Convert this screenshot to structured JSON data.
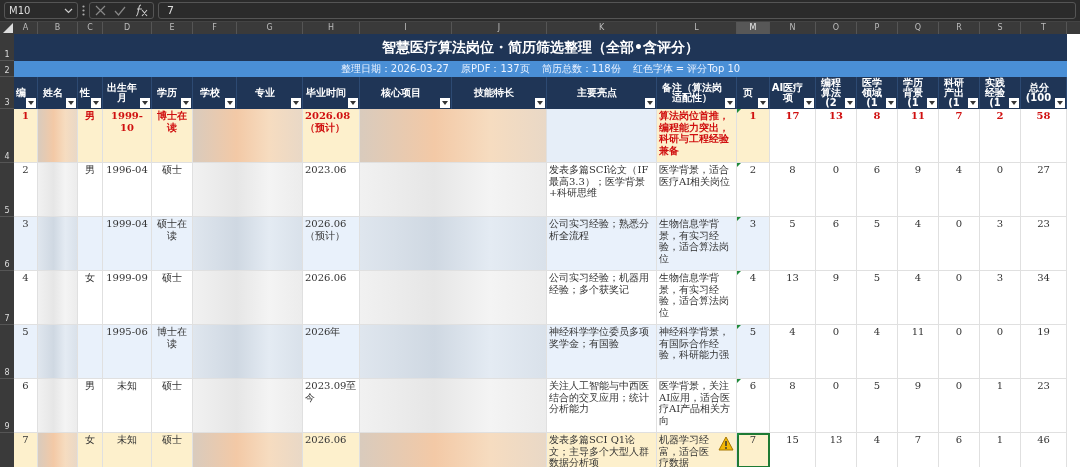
{
  "formula_bar": {
    "cell_ref": "M10",
    "value": "7"
  },
  "columns": [
    {
      "letter": "A",
      "selected": false
    },
    {
      "letter": "B",
      "selected": false
    },
    {
      "letter": "C",
      "selected": false
    },
    {
      "letter": "D",
      "selected": false
    },
    {
      "letter": "E",
      "selected": false
    },
    {
      "letter": "F",
      "selected": false
    },
    {
      "letter": "G",
      "selected": false
    },
    {
      "letter": "H",
      "selected": false
    },
    {
      "letter": "I",
      "selected": false
    },
    {
      "letter": "J",
      "selected": false
    },
    {
      "letter": "K",
      "selected": false
    },
    {
      "letter": "L",
      "selected": false
    },
    {
      "letter": "M",
      "selected": true
    },
    {
      "letter": "N",
      "selected": false
    },
    {
      "letter": "O",
      "selected": false
    },
    {
      "letter": "P",
      "selected": false
    },
    {
      "letter": "Q",
      "selected": false
    },
    {
      "letter": "R",
      "selected": false
    },
    {
      "letter": "S",
      "selected": false
    },
    {
      "letter": "T",
      "selected": false
    }
  ],
  "title": {
    "row_label": "1",
    "text": "智慧医疗算法岗位・简历筛选整理（全部•含评分）"
  },
  "info": {
    "row_label": "2",
    "items": [
      "整理日期：2026-03-27",
      "原PDF：137页",
      "简历总数：118份",
      "红色字体 = 评分Top 10"
    ]
  },
  "header_row_label": "3",
  "headers": [
    "编",
    "姓名",
    "性",
    "出生年月",
    "学历",
    "学校",
    "专业",
    "毕业时间",
    "核心项目",
    "技能特长",
    "主要亮点",
    "备注（算法岗适配性）",
    "页",
    "AI医疗项",
    "编程算法(2",
    "医学领域(1",
    "学历背景(1",
    "科研产出(1",
    "实践经验(1",
    "总分(100"
  ],
  "rows": [
    {
      "row_label": "4",
      "color": "#fdf0cc",
      "top10": true,
      "no": "1",
      "gender": "男",
      "birth": "1999-10",
      "education": "博士在读",
      "graduation": "2026.08（预计）",
      "highlight": "",
      "note": "算法岗位首推，编程能力突出，科研与工程经验兼备",
      "page": "1",
      "page_selected": false,
      "warning": false,
      "scores": [
        "17",
        "13",
        "8",
        "11",
        "7",
        "2",
        "58"
      ]
    },
    {
      "row_label": "5",
      "color": "#ffffff",
      "top10": false,
      "no": "2",
      "gender": "男",
      "birth": "1996-04",
      "education": "硕士",
      "graduation": "2023.06",
      "highlight": "发表多篇SCI论文（IF最高3.3）；医学背景+科研思维",
      "note": "医学背景，适合医疗AI相关岗位",
      "page": "2",
      "page_selected": false,
      "warning": false,
      "scores": [
        "8",
        "0",
        "6",
        "9",
        "4",
        "0",
        "27"
      ]
    },
    {
      "row_label": "6",
      "color": "#e9f1fb",
      "top10": false,
      "no": "3",
      "birth": "1999-04",
      "education": "硕士在读",
      "graduation": "2026.06（预计）",
      "highlight": "公司实习经验；熟悉分析全流程",
      "note": "生物信息学背景，有实习经验，适合算法岗位",
      "page": "3",
      "page_selected": false,
      "warning": false,
      "scores": [
        "5",
        "6",
        "5",
        "4",
        "0",
        "3",
        "23"
      ]
    },
    {
      "row_label": "7",
      "color": "#ffffff",
      "top10": false,
      "no": "4",
      "gender": "女",
      "birth": "1999-09",
      "education": "硕士",
      "graduation": "2026.06",
      "highlight": "公司实习经验；机器用经验；多个获奖记",
      "note": "生物信息学背景，有实习经验，适合算法岗位",
      "page": "4",
      "page_selected": false,
      "warning": false,
      "scores": [
        "13",
        "9",
        "5",
        "4",
        "0",
        "3",
        "34"
      ]
    },
    {
      "row_label": "8",
      "color": "#e9f1fb",
      "top10": false,
      "no": "5",
      "birth": "1995-06",
      "education": "博士在读",
      "graduation": "2026年",
      "highlight": "神经科学学位委员多项奖学金；有国验",
      "note": "神经科学背景，有国际合作经验，科研能力强",
      "page": "5",
      "page_selected": false,
      "warning": false,
      "scores": [
        "4",
        "0",
        "4",
        "11",
        "0",
        "0",
        "19"
      ]
    },
    {
      "row_label": "9",
      "color": "#ffffff",
      "top10": false,
      "no": "6",
      "gender": "男",
      "birth": "未知",
      "education": "硕士",
      "graduation": "2023.09至今",
      "highlight": "关注人工智能与中西医结合的交叉应用；统计分析能力",
      "note": "医学背景，关注AI应用，适合医疗AI产品相关方向",
      "page": "6",
      "page_selected": false,
      "warning": false,
      "scores": [
        "8",
        "0",
        "5",
        "9",
        "0",
        "1",
        "23"
      ]
    },
    {
      "color": "#fdf0cc",
      "top10": false,
      "no": "7",
      "gender": "女",
      "birth": "未知",
      "education": "硕士",
      "graduation": "2026.06",
      "highlight": "发表多篇SCI Q1论文；主导多个大型人群数据分析项",
      "note": "机器学习经富，适合医疗数据",
      "page": "7",
      "page_selected": true,
      "warning": true,
      "scores": [
        "15",
        "13",
        "4",
        "7",
        "6",
        "1",
        "46"
      ]
    }
  ]
}
